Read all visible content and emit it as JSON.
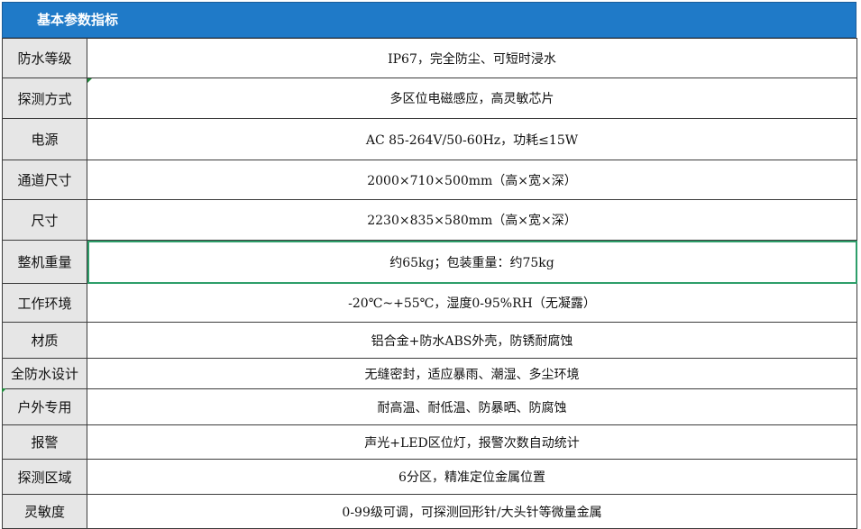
{
  "header": {
    "title": "基本参数指标"
  },
  "rows": [
    {
      "label": "防水等级",
      "value": "IP67，完全防尘、可短时浸水"
    },
    {
      "label": "探测方式",
      "value": "多区位电磁感应，高灵敏芯片"
    },
    {
      "label": "电源",
      "value": "AC 85-264V/50-60Hz，功耗≤15W"
    },
    {
      "label": "通道尺寸",
      "value": "2000×710×500mm（高×宽×深）"
    },
    {
      "label": "尺寸",
      "value": "2230×835×580mm（高×宽×深）"
    },
    {
      "label": "整机重量",
      "value": "约65kg；包装重量：约75kg"
    },
    {
      "label": "工作环境",
      "value": "-20℃~+55℃，湿度0-95%RH（无凝露）"
    },
    {
      "label": "材质",
      "value": "铝合金+防水ABS外壳，防锈耐腐蚀"
    },
    {
      "label": "全防水设计",
      "value": "无缝密封，适应暴雨、潮湿、多尘环境"
    },
    {
      "label": "户外专用",
      "value": "耐高温、耐低温、防暴晒、防腐蚀"
    },
    {
      "label": "报警",
      "value": "声光+LED区位灯，报警次数自动统计"
    },
    {
      "label": "探测区域",
      "value": "6分区，精准定位金属位置"
    },
    {
      "label": "灵敏度",
      "value": "0-99级可调，可探测回形针/大头针等微量金属"
    }
  ]
}
